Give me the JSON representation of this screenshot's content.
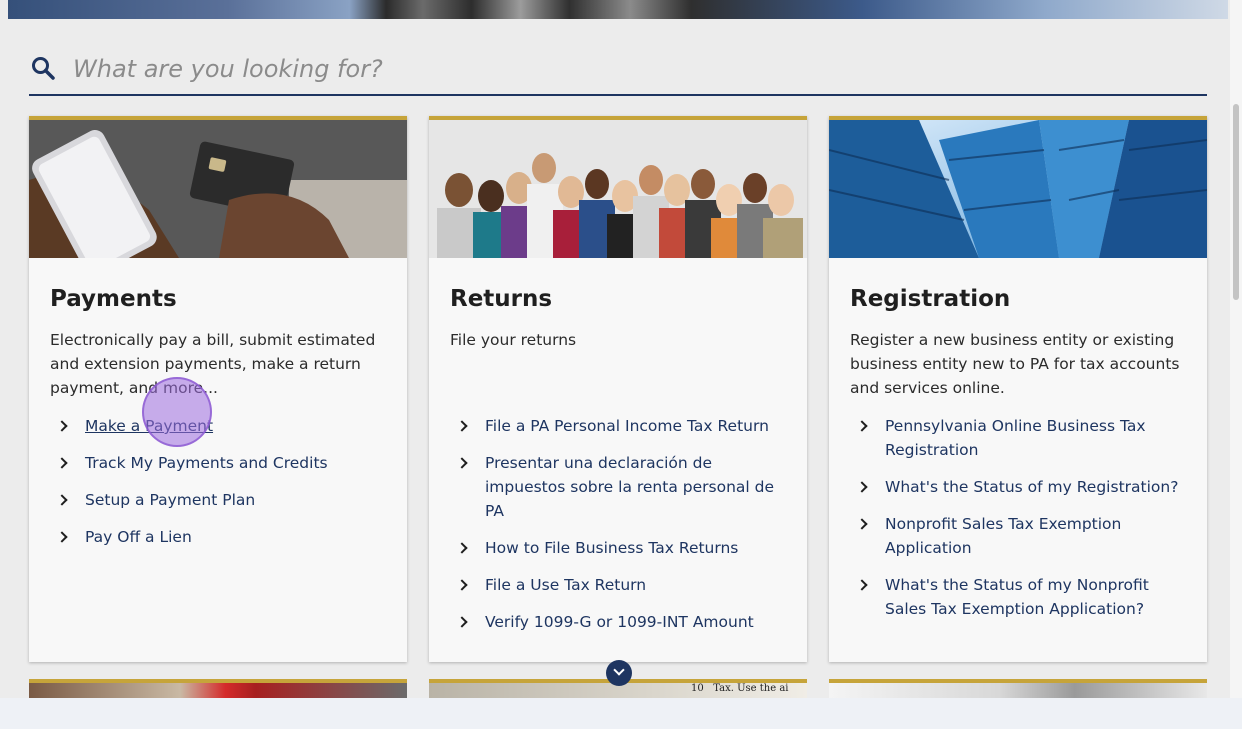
{
  "search": {
    "placeholder": "What are you looking for?",
    "icon": "search-icon"
  },
  "cards": [
    {
      "title": "Payments",
      "description": "Electronically pay a bill, submit estimated and extension payments, make a return payment, and more...",
      "links": [
        "Make a Payment",
        "Track My Payments and Credits",
        "Setup a Payment Plan",
        "Pay Off a Lien"
      ]
    },
    {
      "title": "Returns",
      "description": "File your returns",
      "links": [
        "File a PA Personal Income Tax Return",
        "Presentar una declaración de impuestos sobre la renta personal de PA",
        "How to File Business Tax Returns",
        "File a Use Tax Return",
        "Verify 1099-G or 1099-INT Amount"
      ]
    },
    {
      "title": "Registration",
      "description": "Register a new business entity or existing business entity new to PA for tax accounts and services online.",
      "links": [
        "Pennsylvania Online Business Tax Registration",
        "What's the Status of my Registration?",
        "Nonprofit Sales Tax Exemption Application",
        "What's the Status of my Nonprofit Sales Tax Exemption Application?"
      ]
    }
  ],
  "partial_cards": {
    "middle_snippet": "10   Tax. Use the ai"
  },
  "colors": {
    "accent_gold": "#c6a43a",
    "navy": "#1e3561",
    "page_bg": "#ececec"
  }
}
